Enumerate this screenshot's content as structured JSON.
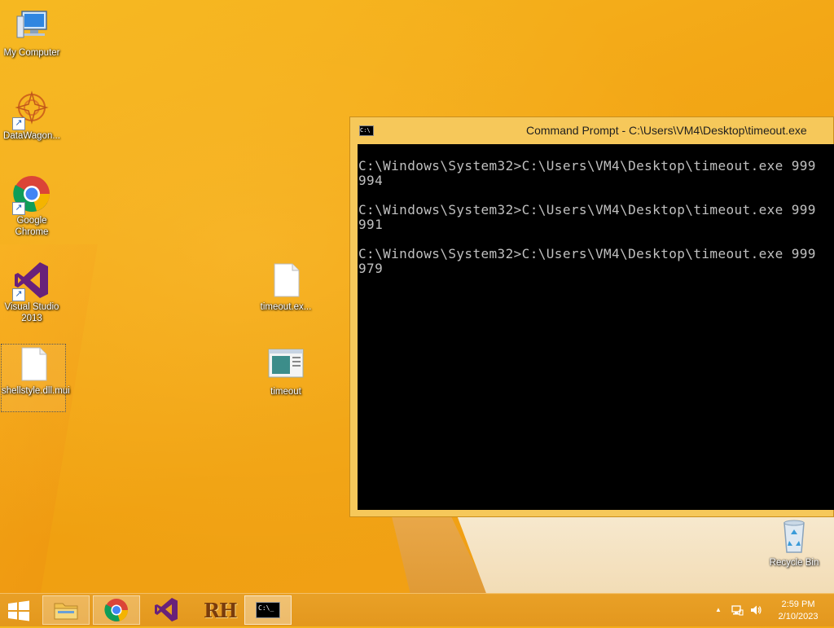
{
  "desktop": {
    "icons": [
      {
        "label": "My Computer"
      },
      {
        "label": "DataWagon..."
      },
      {
        "label": "Google Chrome"
      },
      {
        "label": "Visual Studio 2013"
      },
      {
        "label": "shellstyle.dll.mui"
      },
      {
        "label": "timeout.ex..."
      },
      {
        "label": "timeout"
      },
      {
        "label": "Recycle Bin"
      }
    ]
  },
  "cmd_window": {
    "title": "Command Prompt - C:\\Users\\VM4\\Desktop\\timeout.exe",
    "icon_text": "C:\\",
    "lines": [
      {
        "command": "C:\\Windows\\System32>C:\\Users\\VM4\\Desktop\\timeout.exe 999",
        "output": "994"
      },
      {
        "command": "C:\\Windows\\System32>C:\\Users\\VM4\\Desktop\\timeout.exe 999",
        "output": "991"
      },
      {
        "command": "C:\\Windows\\System32>C:\\Users\\VM4\\Desktop\\timeout.exe 999",
        "output": "979"
      }
    ]
  },
  "taskbar": {
    "rh_label": "RH",
    "cmd_icon_text": "C:\\_",
    "clock": {
      "time": "2:59 PM",
      "date": "2/10/2023"
    },
    "tray_arrow": "▲"
  },
  "colors": {
    "desktop": "#f3a716",
    "console_bg": "#000000",
    "console_text": "#c0c0c0",
    "window_frame": "#f6c85a"
  }
}
